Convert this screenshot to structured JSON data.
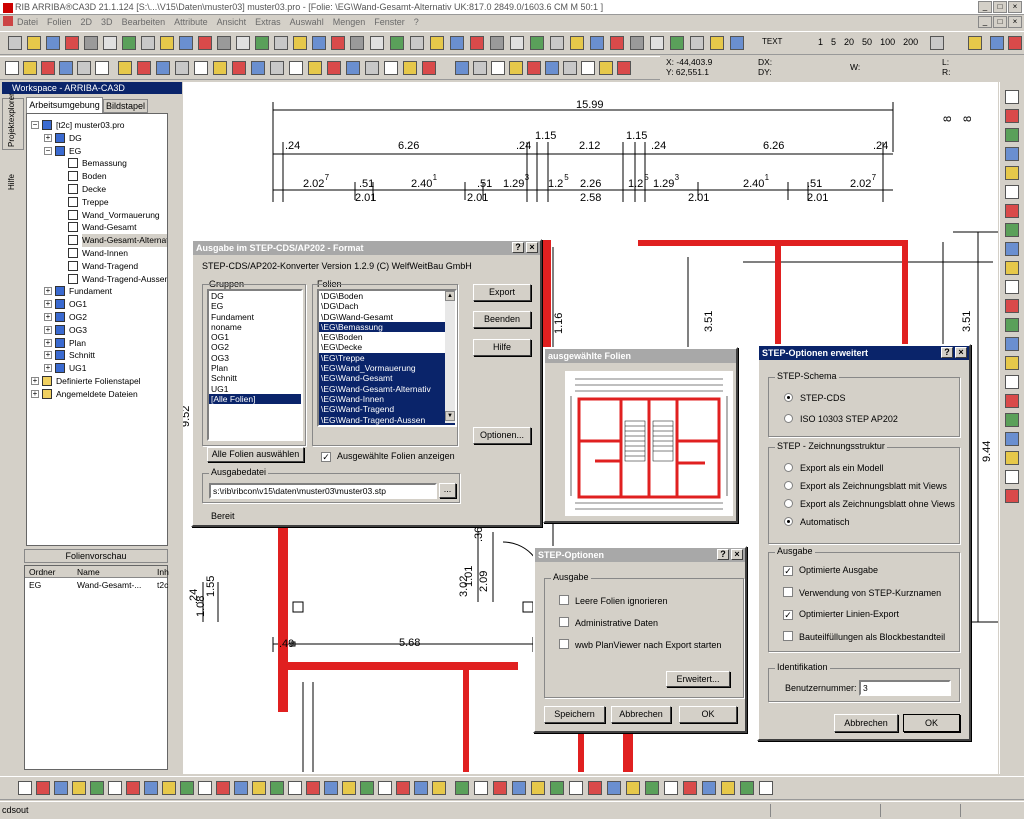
{
  "window": {
    "title": "RIB ARRIBA®CA3D 21.1.124 [S:\\...\\V15\\Daten\\muster03] muster03.pro - [Folie: \\EG\\Wand-Gesamt-Alternativ    UK:817.0    2849.0/1603.6 CM    M 50:1 ]",
    "controls": [
      "_",
      "□",
      "×"
    ],
    "inner_controls": [
      "_",
      "□",
      "×"
    ]
  },
  "menu": [
    "Datei",
    "Folien",
    "2D",
    "3D",
    "Bearbeiten",
    "Attribute",
    "Ansicht",
    "Extras",
    "Auswahl",
    "Mengen",
    "Fenster",
    "?"
  ],
  "toolbar": {
    "text_label": "TEXT",
    "scales": [
      "1",
      "5",
      "20",
      "50",
      "100",
      "200"
    ]
  },
  "coords": {
    "x": "X: -44,403.9",
    "y": "Y: 62,551.1",
    "dx": "DX:",
    "dy": "DY:",
    "w": "W:",
    "l": "L:",
    "r": "R:"
  },
  "workspace": {
    "title": "Workspace - ARRIBA-CA3D",
    "tabs": [
      "Arbeitsumgebung",
      "Bildstapel"
    ],
    "side_tabs": [
      "Projektexplorer",
      "Hilfe"
    ],
    "tree": [
      {
        "label": "[t2c] muster03.pro",
        "level": 0,
        "icon": "project"
      },
      {
        "label": "DG",
        "level": 1,
        "icon": "floor"
      },
      {
        "label": "EG",
        "level": 1,
        "icon": "floor"
      },
      {
        "label": "Bemassung",
        "level": 2,
        "icon": "sheet"
      },
      {
        "label": "Boden",
        "level": 2,
        "icon": "sheet"
      },
      {
        "label": "Decke",
        "level": 2,
        "icon": "sheet"
      },
      {
        "label": "Treppe",
        "level": 2,
        "icon": "sheet"
      },
      {
        "label": "Wand_Vormauerung",
        "level": 2,
        "icon": "sheet"
      },
      {
        "label": "Wand-Gesamt",
        "level": 2,
        "icon": "sheet"
      },
      {
        "label": "Wand-Gesamt-Alternativ",
        "level": 2,
        "icon": "sheet"
      },
      {
        "label": "Wand-Innen",
        "level": 2,
        "icon": "sheet"
      },
      {
        "label": "Wand-Tragend",
        "level": 2,
        "icon": "sheet"
      },
      {
        "label": "Wand-Tragend-Aussen",
        "level": 2,
        "icon": "sheet"
      },
      {
        "label": "Fundament",
        "level": 1,
        "icon": "floor"
      },
      {
        "label": "OG1",
        "level": 1,
        "icon": "floor"
      },
      {
        "label": "OG2",
        "level": 1,
        "icon": "floor"
      },
      {
        "label": "OG3",
        "level": 1,
        "icon": "floor"
      },
      {
        "label": "Plan",
        "level": 1,
        "icon": "floor"
      },
      {
        "label": "Schnitt",
        "level": 1,
        "icon": "floor"
      },
      {
        "label": "UG1",
        "level": 1,
        "icon": "floor"
      },
      {
        "label": "Definierte Folienstapel",
        "level": 0,
        "icon": "folder"
      },
      {
        "label": "Angemeldete Dateien",
        "level": 0,
        "icon": "folder"
      }
    ],
    "preview": {
      "title": "Folienvorschau",
      "columns": [
        "Ordner",
        "Name",
        "Inh"
      ],
      "rows": [
        [
          "EG",
          "Wand-Gesamt-...",
          "t2c"
        ]
      ]
    }
  },
  "drawing": {
    "dims_top": [
      "15.99"
    ],
    "dims_row2": [
      ".24",
      "6.26",
      ".24",
      "1.15",
      "2.12",
      "1.15",
      ".24",
      "6.26",
      ".24",
      "8",
      "8"
    ],
    "dims_row3": [
      [
        "2.02",
        "7"
      ],
      [
        ".51",
        ""
      ],
      [
        "2.40",
        "1"
      ],
      [
        ".51",
        ""
      ],
      [
        "1.29",
        "3"
      ],
      [
        "1.2",
        "5"
      ],
      [
        "2.26",
        ""
      ],
      [
        "1.2",
        "5"
      ],
      [
        "1.29",
        "3"
      ],
      [
        "2.40",
        "1"
      ],
      [
        ".51",
        ""
      ],
      [
        "2.02",
        "7"
      ]
    ],
    "dims_row3b": [
      "2.01",
      "2.01",
      "2.58",
      "2.01",
      "2.01"
    ],
    "dims_vertical": [
      "3.51",
      "3.51",
      "1.16",
      "9.44",
      "9.52",
      "1.01",
      "2.09",
      "3.02",
      "1.08",
      ".24",
      "1.55",
      ".365"
    ],
    "dims_bottom": [
      "5.68",
      ".49"
    ]
  },
  "step_dialog": {
    "title": "Ausgabe im STEP-CDS/AP202 - Format",
    "version": "STEP-CDS/AP202-Konverter Version 1.2.9 (C) WelfWeitBau GmbH",
    "groups_label": "Gruppen",
    "groups": [
      "DG",
      "EG",
      "Fundament",
      "noname",
      "OG1",
      "OG2",
      "OG3",
      "Plan",
      "Schnitt",
      "UG1",
      "[Alle Folien]"
    ],
    "groups_selected": 10,
    "folien_label": "Folien",
    "folien": [
      "\\DG\\Boden",
      "\\DG\\Dach",
      "\\DG\\Wand-Gesamt",
      "\\EG\\Bemassung",
      "\\EG\\Boden",
      "\\EG\\Decke",
      "\\EG\\Treppe",
      "\\EG\\Wand_Vormauerung",
      "\\EG\\Wand-Gesamt",
      "\\EG\\Wand-Gesamt-Alternativ",
      "\\EG\\Wand-Innen",
      "\\EG\\Wand-Tragend",
      "\\EG\\Wand-Tragend-Aussen"
    ],
    "folien_selected": [
      3,
      6,
      7,
      8,
      9,
      10,
      11,
      12
    ],
    "btn_export": "Export",
    "btn_beenden": "Beenden",
    "btn_hilfe": "Hilfe",
    "btn_optionen": "Optionen...",
    "btn_alle": "Alle Folien auswählen",
    "cb_anzeigen": "Ausgewählte Folien anzeigen",
    "cb_anzeigen_checked": true,
    "ausgabedatei_label": "Ausgabedatei",
    "ausgabedatei": "s:\\rib\\ribcon\\v15\\daten\\muster03\\muster03.stp",
    "browse": "...",
    "status": "Bereit"
  },
  "selected_dialog": {
    "title": "ausgewählte Folien"
  },
  "options_dialog": {
    "title": "STEP-Optionen",
    "group": "Ausgabe",
    "checks": [
      "Leere Folien ignorieren",
      "Administrative Daten",
      "wwb PlanViewer nach Export starten"
    ],
    "btn_erweitert": "Erweitert...",
    "btn_speichern": "Speichern",
    "btn_abbrechen": "Abbrechen",
    "btn_ok": "OK"
  },
  "ext_dialog": {
    "title": "STEP-Optionen erweitert",
    "schema_label": "STEP-Schema",
    "schema": [
      "STEP-CDS",
      "ISO 10303 STEP AP202"
    ],
    "schema_selected": 0,
    "struct_label": "STEP - Zeichnungsstruktur",
    "struct": [
      "Export als ein Modell",
      "Export als Zeichnungsblatt mit Views",
      "Export als Zeichnungsblatt ohne Views",
      "Automatisch"
    ],
    "struct_selected": 3,
    "ausgabe_label": "Ausgabe",
    "ausgabe": [
      "Optimierte Ausgabe",
      "Verwendung von STEP-Kurznamen",
      "Optimierter Linien-Export",
      "Bauteilfüllungen als Blockbestandteil"
    ],
    "ausgabe_checked": [
      true,
      false,
      true,
      false
    ],
    "ident_label": "Identifikation",
    "user_label": "Benutzernummer:",
    "user_value": "3",
    "btn_abbrechen": "Abbrechen",
    "btn_ok": "OK"
  },
  "statusbar": {
    "text": "cdsout"
  },
  "colors": {
    "wall": "#e02020",
    "title_active": "#0a246a",
    "title_inactive": "#a8a8a8"
  }
}
